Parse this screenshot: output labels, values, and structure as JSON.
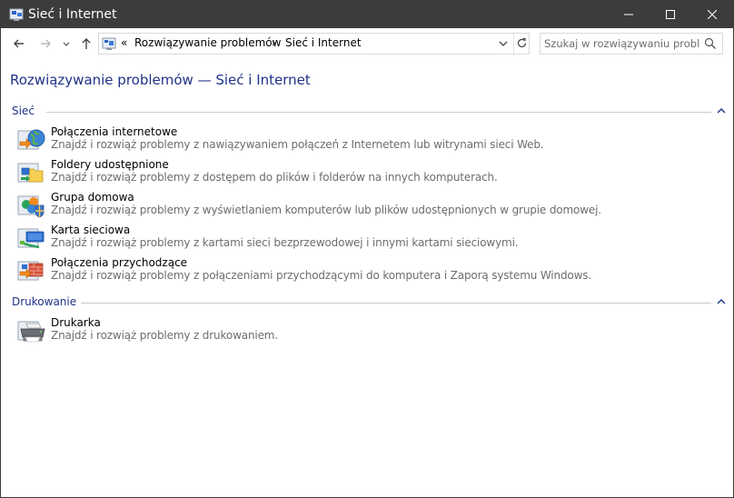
{
  "window": {
    "title": "Sieć i Internet",
    "icon": "network-troubleshoot-icon"
  },
  "address_bar": {
    "overflow": "«",
    "breadcrumbs": [
      {
        "label": "Rozwiązywanie problemów"
      },
      {
        "label": "Sieć i Internet"
      }
    ],
    "separator": "›"
  },
  "search": {
    "placeholder": "Szukaj w rozwiązywaniu probl..."
  },
  "page": {
    "title": "Rozwiązywanie problemów — Sieć i Internet"
  },
  "sections": [
    {
      "label": "Sieć",
      "items": [
        {
          "name": "Połączenia internetowe",
          "description": "Znajdź i rozwiąż problemy z nawiązywaniem połączeń z Internetem lub witrynami sieci Web.",
          "icon": "internet-globe-icon"
        },
        {
          "name": "Foldery udostępnione",
          "description": "Znajdź i rozwiąż problemy z dostępem do plików i folderów na innych komputerach.",
          "icon": "shared-folder-icon"
        },
        {
          "name": "Grupa domowa",
          "description": "Znajdź i rozwiąż problemy z wyświetlaniem komputerów lub plików udostępnionych w grupie domowej.",
          "icon": "homegroup-icon"
        },
        {
          "name": "Karta sieciowa",
          "description": "Znajdź i rozwiąż problemy z kartami sieci bezprzewodowej i innymi kartami sieciowymi.",
          "icon": "network-adapter-icon"
        },
        {
          "name": "Połączenia przychodzące",
          "description": "Znajdź i rozwiąż problemy z połączeniami przychodzącymi do komputera i Zaporą systemu Windows.",
          "icon": "incoming-connections-icon"
        }
      ]
    },
    {
      "label": "Drukowanie",
      "items": [
        {
          "name": "Drukarka",
          "description": "Znajdź i rozwiąż problemy z drukowaniem.",
          "icon": "printer-icon"
        }
      ]
    }
  ],
  "colors": {
    "titlebar": "#3c3c3c",
    "heading": "#1e3287",
    "description": "#6d6d6d"
  }
}
